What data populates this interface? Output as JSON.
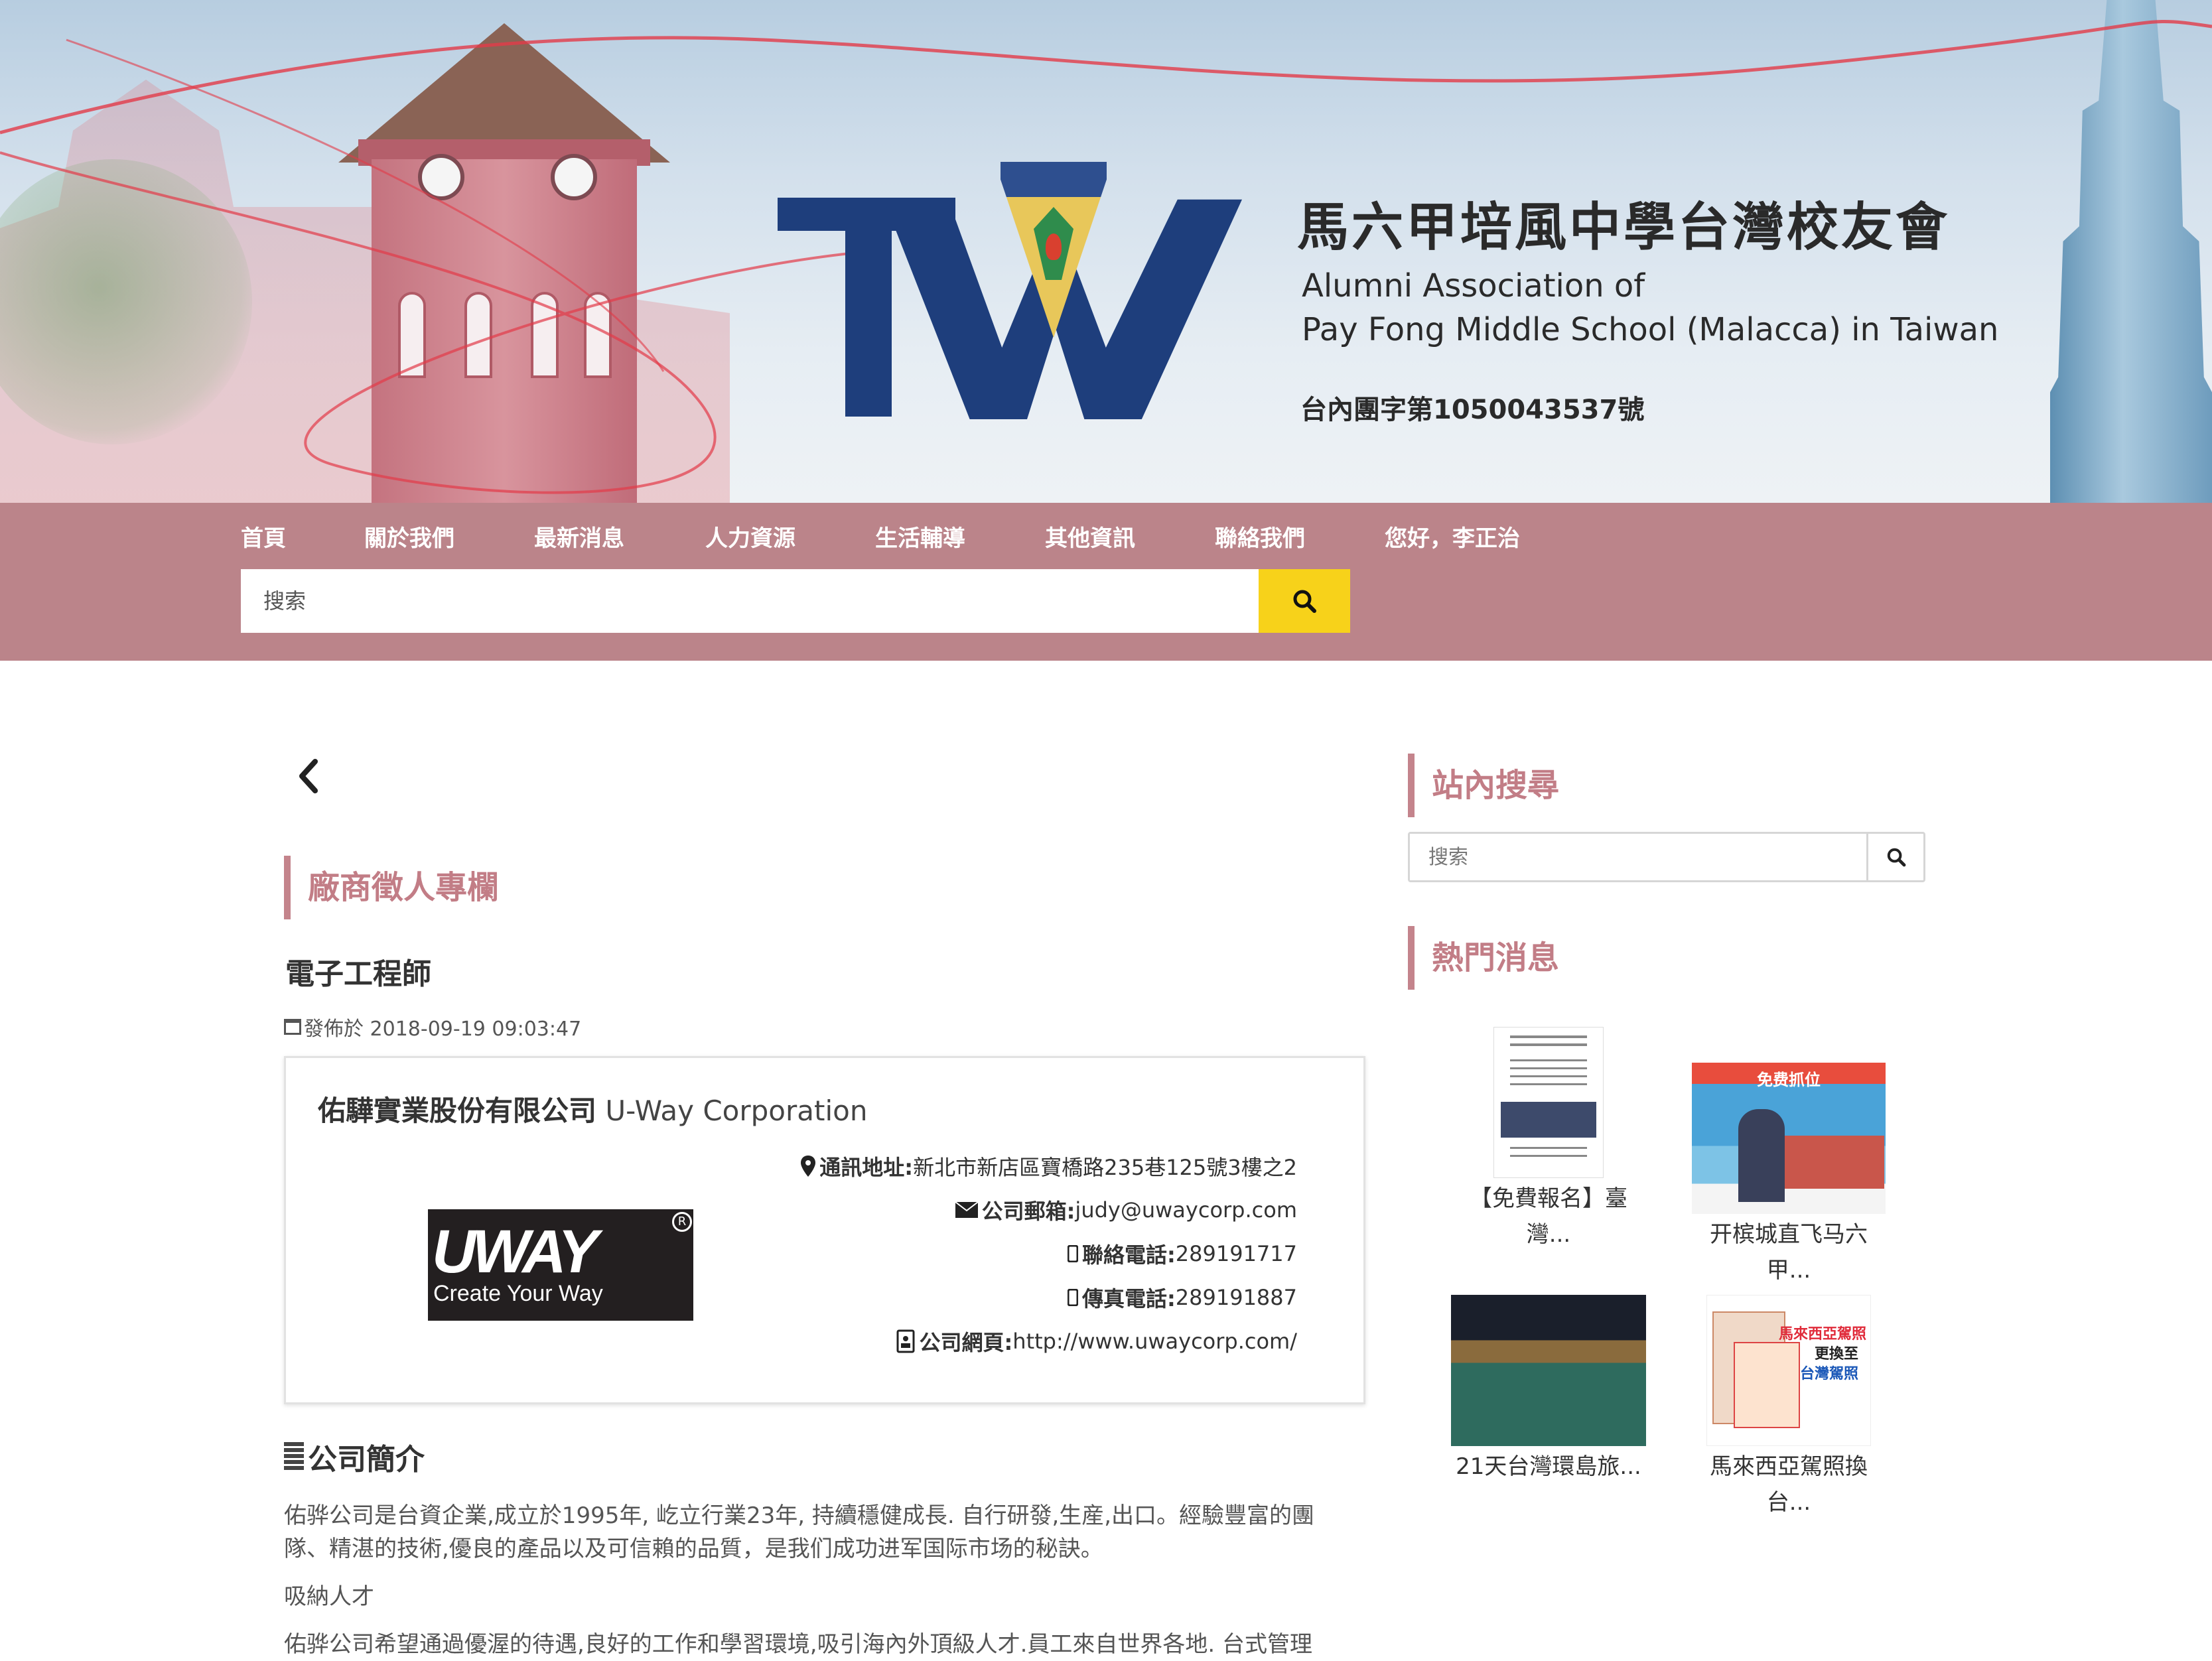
{
  "banner": {
    "title_zh": "馬六甲培風中學台灣校友會",
    "title_en_line1": "Alumni Association of",
    "title_en_line2": "Pay Fong Middle School (Malacca) in Taiwan",
    "registration": "台內團字第1050043537號",
    "logo_text": "TW",
    "colors": {
      "logo": "#1e3e7c",
      "ribbon": "#e23b48"
    }
  },
  "nav": {
    "items": [
      {
        "label": "首頁"
      },
      {
        "label": "關於我們"
      },
      {
        "label": "最新消息"
      },
      {
        "label": "人力資源"
      },
      {
        "label": "生活輔導"
      },
      {
        "label": "其他資訊"
      },
      {
        "label": "聯絡我們"
      },
      {
        "label": "您好，李正治"
      }
    ],
    "search_placeholder": "搜索",
    "search_icon": "search-icon",
    "colors": {
      "bar": "#bb848a",
      "search_button": "#f7d21a"
    }
  },
  "main": {
    "back_icon": "chevron-left-icon",
    "section_title": "廠商徵人專欄",
    "job_title": "電子工程師",
    "posted": "發佈於 2018-09-19 09:03:47",
    "company": {
      "name_zh": "佑驊實業股份有限公司",
      "name_en": "U-Way Corporation",
      "logo_word": "UWAY",
      "logo_tagline": "Create Your Way",
      "logo_reg": "R",
      "address_label": "通訊地址:",
      "address": "新北市新店區寶橋路235巷125號3樓之2",
      "email_label": "公司郵箱:",
      "email": "judy@uwaycorp.com",
      "phone_label": "聯絡電話:",
      "phone": "289191717",
      "fax_label": "傳真電話:",
      "fax": "289191887",
      "web_label": "公司網頁:",
      "web": "http://www.uwaycorp.com/"
    },
    "intro_heading": "公司簡介",
    "intro_p1_line1": "佑骅公司是台資企業,成立於1995年, 屹立行業23年, 持續穩健成長. 自行研發,生産,出口。經驗豐富的團",
    "intro_p1_line2": "隊、精湛的技術,優良的產品以及可信賴的品質，是我们成功进军国际市场的秘訣。",
    "intro_p2": "吸納人才",
    "intro_p3": "佑骅公司希望通過優渥的待遇,良好的工作和學習環境,吸引海內外頂級人才.員工來自世界各地. 台式管理",
    "colors": {
      "accent": "#c27d86"
    }
  },
  "sidebar": {
    "search_title": "站內搜尋",
    "search_placeholder": "搜索",
    "hot_title": "熱門消息",
    "hot": [
      {
        "line1": "【免費報名】臺",
        "line2": "灣..."
      },
      {
        "line1": "开槟城直飞马六",
        "line2": "甲...",
        "thumb_text": "免费抓位"
      },
      {
        "line1": "21天台灣環島旅...",
        "line2": ""
      },
      {
        "line1": "馬來西亞駕照換",
        "line2": "台...",
        "thumb_t1": "馬來西亞駕照",
        "thumb_t2": "更換至",
        "thumb_t3": "台灣駕照"
      }
    ]
  }
}
